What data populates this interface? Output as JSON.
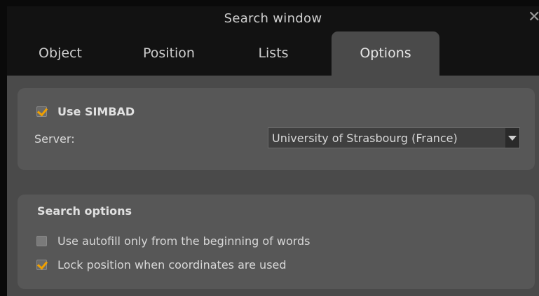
{
  "window": {
    "title": "Search window",
    "close_glyph": "✕"
  },
  "tabs": [
    {
      "label": "Object",
      "active": false
    },
    {
      "label": "Position",
      "active": false
    },
    {
      "label": "Lists",
      "active": false
    },
    {
      "label": "Options",
      "active": true
    }
  ],
  "simbad": {
    "use_label": "Use SIMBAD",
    "use_checked": true,
    "server_label": "Server:",
    "server_value": "University of Strasbourg (France)"
  },
  "search_options": {
    "heading": "Search options",
    "items": [
      {
        "label": "Use autofill only from the beginning of words",
        "checked": false
      },
      {
        "label": "Lock position when coordinates are used",
        "checked": true
      }
    ]
  },
  "colors": {
    "accent_check": "#f0a000",
    "background": "#4a4a4a",
    "titlebar": "#121212"
  }
}
